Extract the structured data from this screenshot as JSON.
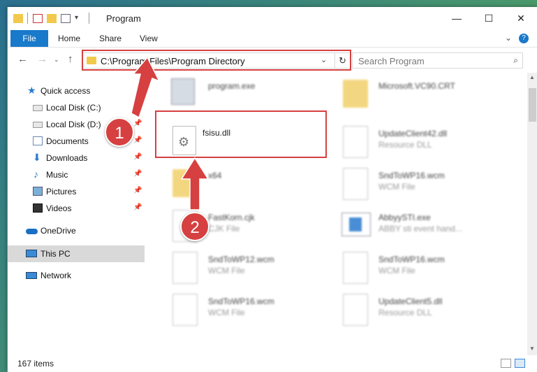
{
  "window": {
    "title": "Program",
    "minimize_icon": "minimize-icon",
    "maximize_icon": "maximize-icon",
    "close_icon": "close-icon"
  },
  "ribbon": {
    "file_label": "File",
    "tabs": [
      "Home",
      "Share",
      "View"
    ]
  },
  "navigation": {
    "address_path": "C:\\Program Files\\Program Directory",
    "search_placeholder": "Search Program"
  },
  "sidebar": {
    "items": [
      {
        "label": "Quick access",
        "icon": "star-icon",
        "pinned": false
      },
      {
        "label": "Local Disk (C:)",
        "icon": "drive-icon",
        "pinned": true
      },
      {
        "label": "Local Disk (D:)",
        "icon": "drive-icon",
        "pinned": true
      },
      {
        "label": "Documents",
        "icon": "documents-icon",
        "pinned": true
      },
      {
        "label": "Downloads",
        "icon": "download-icon",
        "pinned": true
      },
      {
        "label": "Music",
        "icon": "music-icon",
        "pinned": true
      },
      {
        "label": "Pictures",
        "icon": "pictures-icon",
        "pinned": true
      },
      {
        "label": "Videos",
        "icon": "videos-icon",
        "pinned": true
      },
      {
        "label": "OneDrive",
        "icon": "cloud-icon",
        "pinned": false
      },
      {
        "label": "This PC",
        "icon": "computer-icon",
        "pinned": false,
        "selected": true
      },
      {
        "label": "Network",
        "icon": "network-icon",
        "pinned": false
      }
    ]
  },
  "files": [
    {
      "name": "program.exe",
      "type": ""
    },
    {
      "name": "Microsoft.VC90.CRT",
      "type": ""
    },
    {
      "name": "fsisu.dll",
      "type": ""
    },
    {
      "name": "UpdateClient42.dll",
      "type": "Resource DLL"
    },
    {
      "name": "x64",
      "type": ""
    },
    {
      "name": "SndToWP16.wcm",
      "type": "WCM File"
    },
    {
      "name": "FastKorn.cjk",
      "type": "CJK File"
    },
    {
      "name": "AbbyySTI.exe",
      "type": "ABBY sti event hand..."
    },
    {
      "name": "SndToWP12.wcm",
      "type": "WCM File"
    },
    {
      "name": "SndToWP16.wcm",
      "type": "WCM File"
    },
    {
      "name": "SndToWP16.wcm",
      "type": "WCM File"
    },
    {
      "name": "UpdateClient5.dll",
      "type": "Resource DLL"
    }
  ],
  "status": {
    "item_count": "167 items"
  },
  "annotations": {
    "step1": "1",
    "step2": "2"
  },
  "colors": {
    "accent": "#1979ca",
    "highlight": "#d64040"
  }
}
